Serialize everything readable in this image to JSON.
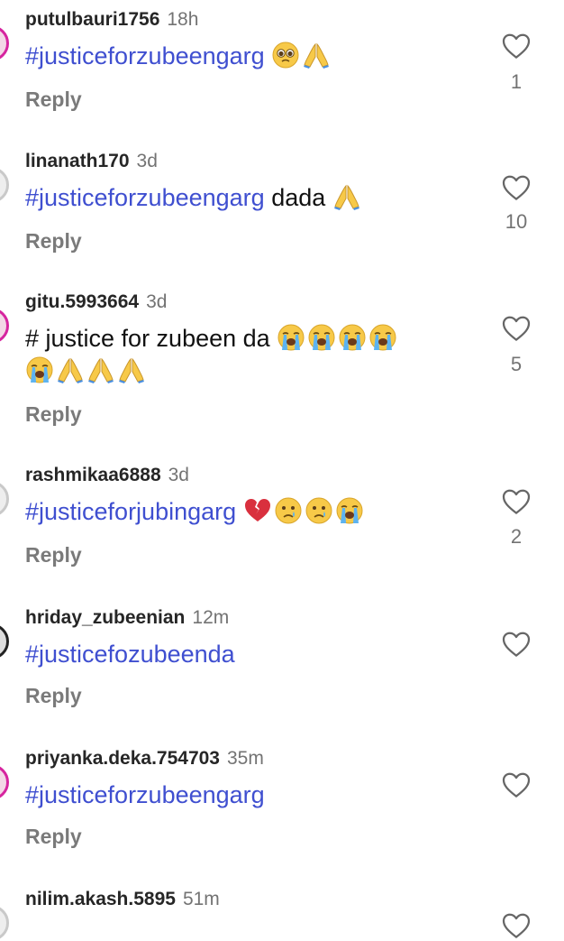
{
  "comments": [
    {
      "username": "putulbauri1756",
      "time": "18h",
      "text_tag": "#justiceforzubeengarg",
      "text_plain": "",
      "reply": "Reply",
      "likes": "1"
    },
    {
      "username": "linanath170",
      "time": "3d",
      "text_tag": "#justiceforzubeengarg",
      "text_plain": " dada",
      "reply": "Reply",
      "likes": "10"
    },
    {
      "username": "gitu.5993664",
      "time": "3d",
      "text_tag": "",
      "text_plain": "# justice for zubeen da",
      "reply": "Reply",
      "likes": "5"
    },
    {
      "username": "rashmikaa6888",
      "time": "3d",
      "text_tag": "#justiceforjubingarg",
      "text_plain": "",
      "reply": "Reply",
      "likes": "2"
    },
    {
      "username": "hriday_zubeenian",
      "time": "12m",
      "text_tag": "#justicefozubeenda",
      "text_plain": "",
      "reply": "Reply",
      "likes": ""
    },
    {
      "username": "priyanka.deka.754703",
      "time": "35m",
      "text_tag": "#justiceforzubeengarg",
      "text_plain": "",
      "reply": "Reply",
      "likes": ""
    },
    {
      "username": "nilim.akash.5895",
      "time": "51m",
      "text_tag": "",
      "text_plain": "",
      "reply": "",
      "likes": ""
    }
  ],
  "icons": {
    "like": "heart-outline-icon",
    "emoji_pleading": "pleading-face-emoji",
    "emoji_pray": "folded-hands-emoji",
    "emoji_cry": "loudly-crying-face-emoji",
    "emoji_broken_heart": "broken-heart-emoji",
    "emoji_sad": "crying-face-emoji"
  },
  "colors": {
    "hashtag": "#3f4fd0",
    "muted": "#737373",
    "story_ring": "#d6249f"
  }
}
